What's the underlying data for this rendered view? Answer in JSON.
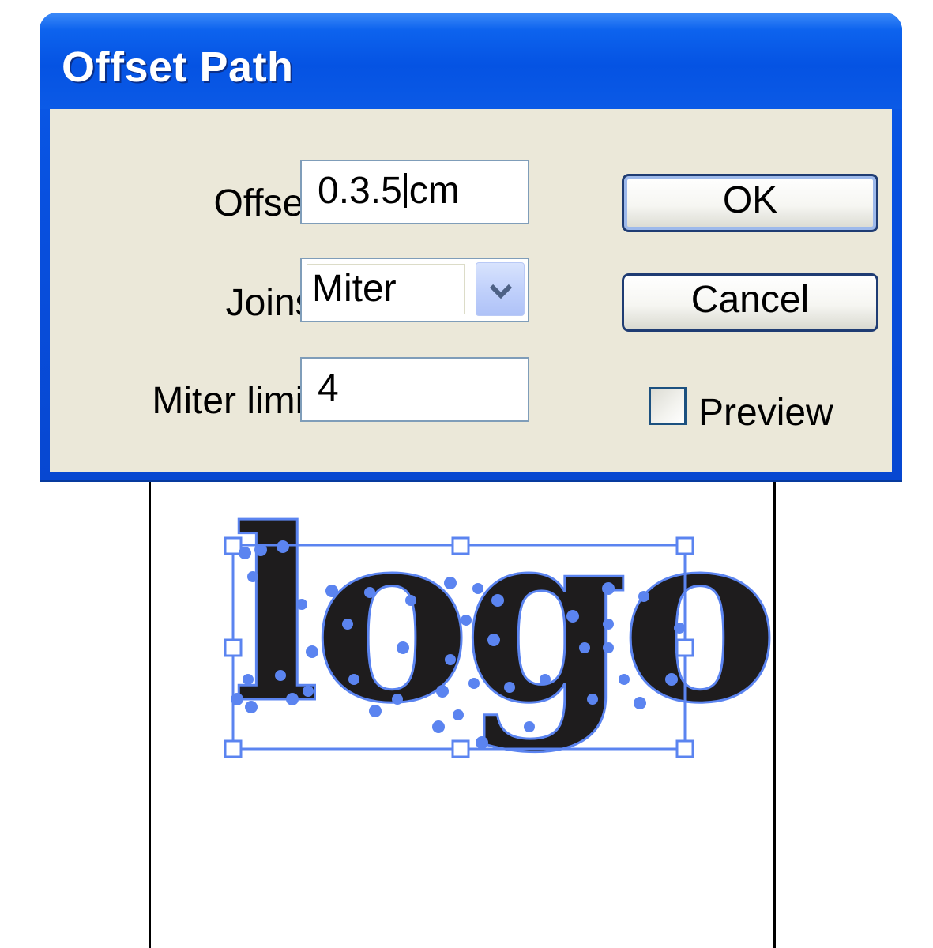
{
  "dialog": {
    "title": "Offset Path",
    "offset": {
      "label": "Offset:",
      "value_before_caret": "0.3.5",
      "value_after_caret": "cm"
    },
    "joins": {
      "label": "Joins:",
      "selected": "Miter"
    },
    "miter_limit": {
      "label": "Miter limit:",
      "value": "4"
    },
    "ok_label": "OK",
    "cancel_label": "Cancel",
    "preview": {
      "label": "Preview",
      "checked": false
    }
  },
  "canvas": {
    "artwork_text": "logo",
    "selection_color": "#5b84f0",
    "fill_color": "#1e1c1d"
  }
}
